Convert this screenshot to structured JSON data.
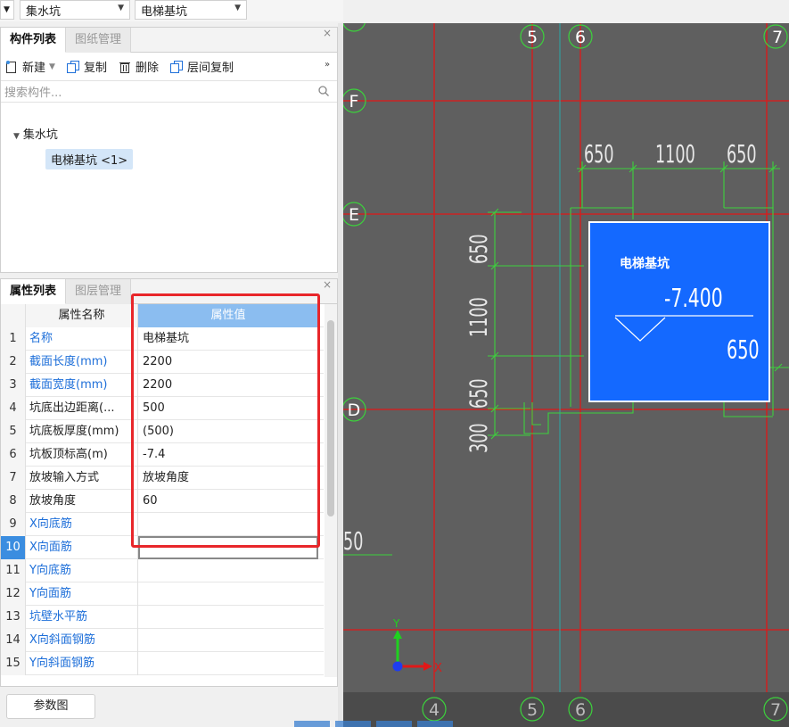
{
  "top_dropdowns": [
    {
      "value": "集水坑"
    },
    {
      "value": "电梯基坑"
    }
  ],
  "component_panel": {
    "tabs": [
      "构件列表",
      "图纸管理"
    ],
    "toolbar": {
      "new_label": "新建",
      "copy_label": "复制",
      "delete_label": "删除",
      "floor_copy_label": "层间复制"
    },
    "search_placeholder": "搜索构件...",
    "tree": {
      "group": "集水坑",
      "item": "电梯基坑 <1>"
    }
  },
  "property_panel": {
    "tabs": [
      "属性列表",
      "图层管理"
    ],
    "header": {
      "name": "属性名称",
      "value": "属性值"
    },
    "rows": [
      {
        "num": "1",
        "name": "名称",
        "value": "电梯基坑",
        "blue": true
      },
      {
        "num": "2",
        "name": "截面长度(mm)",
        "value": "2200",
        "blue": true
      },
      {
        "num": "3",
        "name": "截面宽度(mm)",
        "value": "2200",
        "blue": true
      },
      {
        "num": "4",
        "name": "坑底出边距离(...",
        "value": "500",
        "blue": false
      },
      {
        "num": "5",
        "name": "坑底板厚度(mm)",
        "value": "(500)",
        "blue": false
      },
      {
        "num": "6",
        "name": "坑板顶标高(m)",
        "value": "-7.4",
        "blue": false
      },
      {
        "num": "7",
        "name": "放坡输入方式",
        "value": "放坡角度",
        "blue": false
      },
      {
        "num": "8",
        "name": "放坡角度",
        "value": "60",
        "blue": false
      },
      {
        "num": "9",
        "name": "X向底筋",
        "value": "",
        "blue": true
      },
      {
        "num": "10",
        "name": "X向面筋",
        "value": "",
        "blue": true
      },
      {
        "num": "11",
        "name": "Y向底筋",
        "value": "",
        "blue": true
      },
      {
        "num": "12",
        "name": "Y向面筋",
        "value": "",
        "blue": true
      },
      {
        "num": "13",
        "name": "坑壁水平筋",
        "value": "",
        "blue": true
      },
      {
        "num": "14",
        "name": "X向斜面钢筋",
        "value": "",
        "blue": true
      },
      {
        "num": "15",
        "name": "Y向斜面钢筋",
        "value": "",
        "blue": true
      }
    ],
    "param_button": "参数图"
  },
  "cad": {
    "grid_labels_top": [
      "5",
      "6",
      "7"
    ],
    "grid_labels_left": [
      "F",
      "E",
      "D"
    ],
    "grid_labels_bottom": [
      "4",
      "5",
      "6",
      "7"
    ],
    "dims_top": [
      "650",
      "1100",
      "650"
    ],
    "dims_left": [
      "650",
      "1100",
      "650",
      "300"
    ],
    "dim_right": "650",
    "left_partial": "50",
    "pit_title": "电梯基坑",
    "pit_elevation": "-7.400",
    "axis_x": "X",
    "axis_y": "Y",
    "colors": {
      "background": "#5f5f5f",
      "grid": "#e01818",
      "dims": "#3cd23c",
      "pit": "#1469ff"
    }
  }
}
